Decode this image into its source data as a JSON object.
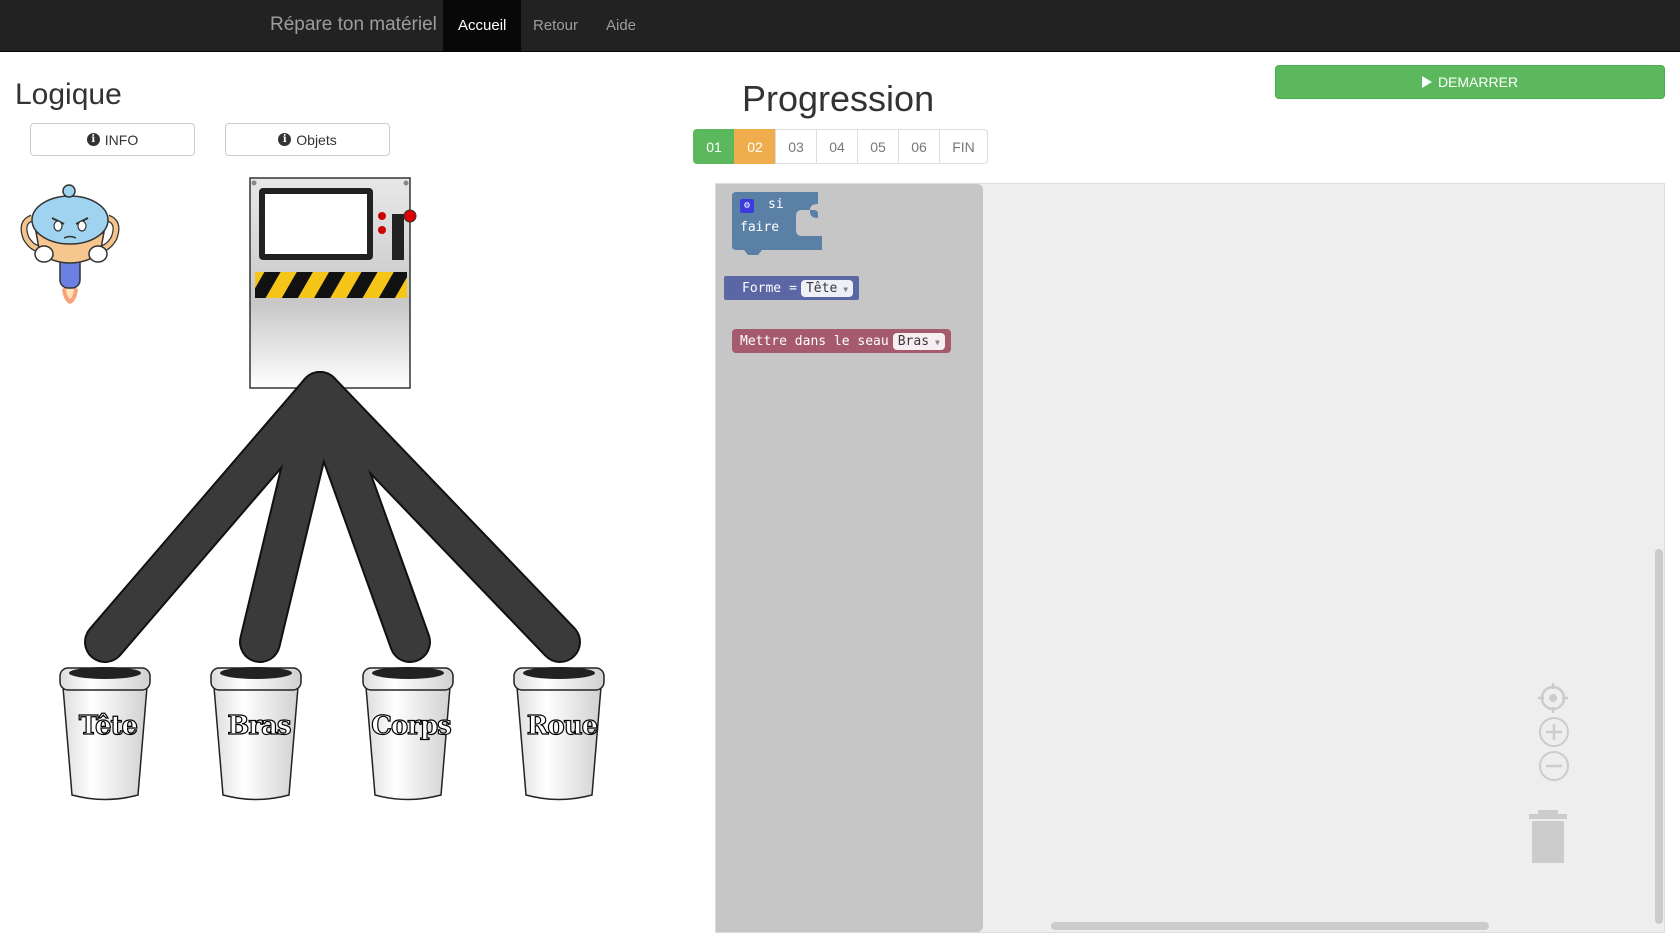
{
  "navbar": {
    "brand": "Répare ton matériel",
    "items": [
      {
        "label": "Accueil",
        "active": true
      },
      {
        "label": "Retour",
        "active": false
      },
      {
        "label": "Aide",
        "active": false
      }
    ]
  },
  "left": {
    "title": "Logique",
    "info_button": "INFO",
    "objects_button": "Objets",
    "buckets": [
      "Tête",
      "Bras",
      "Corps",
      "Roue"
    ]
  },
  "right": {
    "title": "Progression",
    "start_button": "DEMARRER",
    "pages": [
      "01",
      "02",
      "03",
      "04",
      "05",
      "06",
      "FIN"
    ],
    "current_page": "02"
  },
  "blocks": {
    "if_block": {
      "line1": "si",
      "line2": "faire"
    },
    "compare_block": {
      "left": "Forme",
      "op": "=",
      "value": "Tête"
    },
    "action_block": {
      "label": "Mettre dans le seau",
      "value": "Bras"
    }
  },
  "colors": {
    "navbar": "#222222",
    "success": "#5cb85c",
    "warning": "#f0ad4e",
    "if_block": "#5b80a5",
    "compare_block": "#5b67a5",
    "action_block": "#a55b6d",
    "toolbox": "#c6c6c6",
    "workspace": "#eeeeee"
  },
  "icons": [
    "info-icon",
    "play-icon",
    "gear-icon",
    "recenter-icon",
    "zoom-in-icon",
    "zoom-out-icon",
    "trash-icon",
    "robot-mascot"
  ]
}
